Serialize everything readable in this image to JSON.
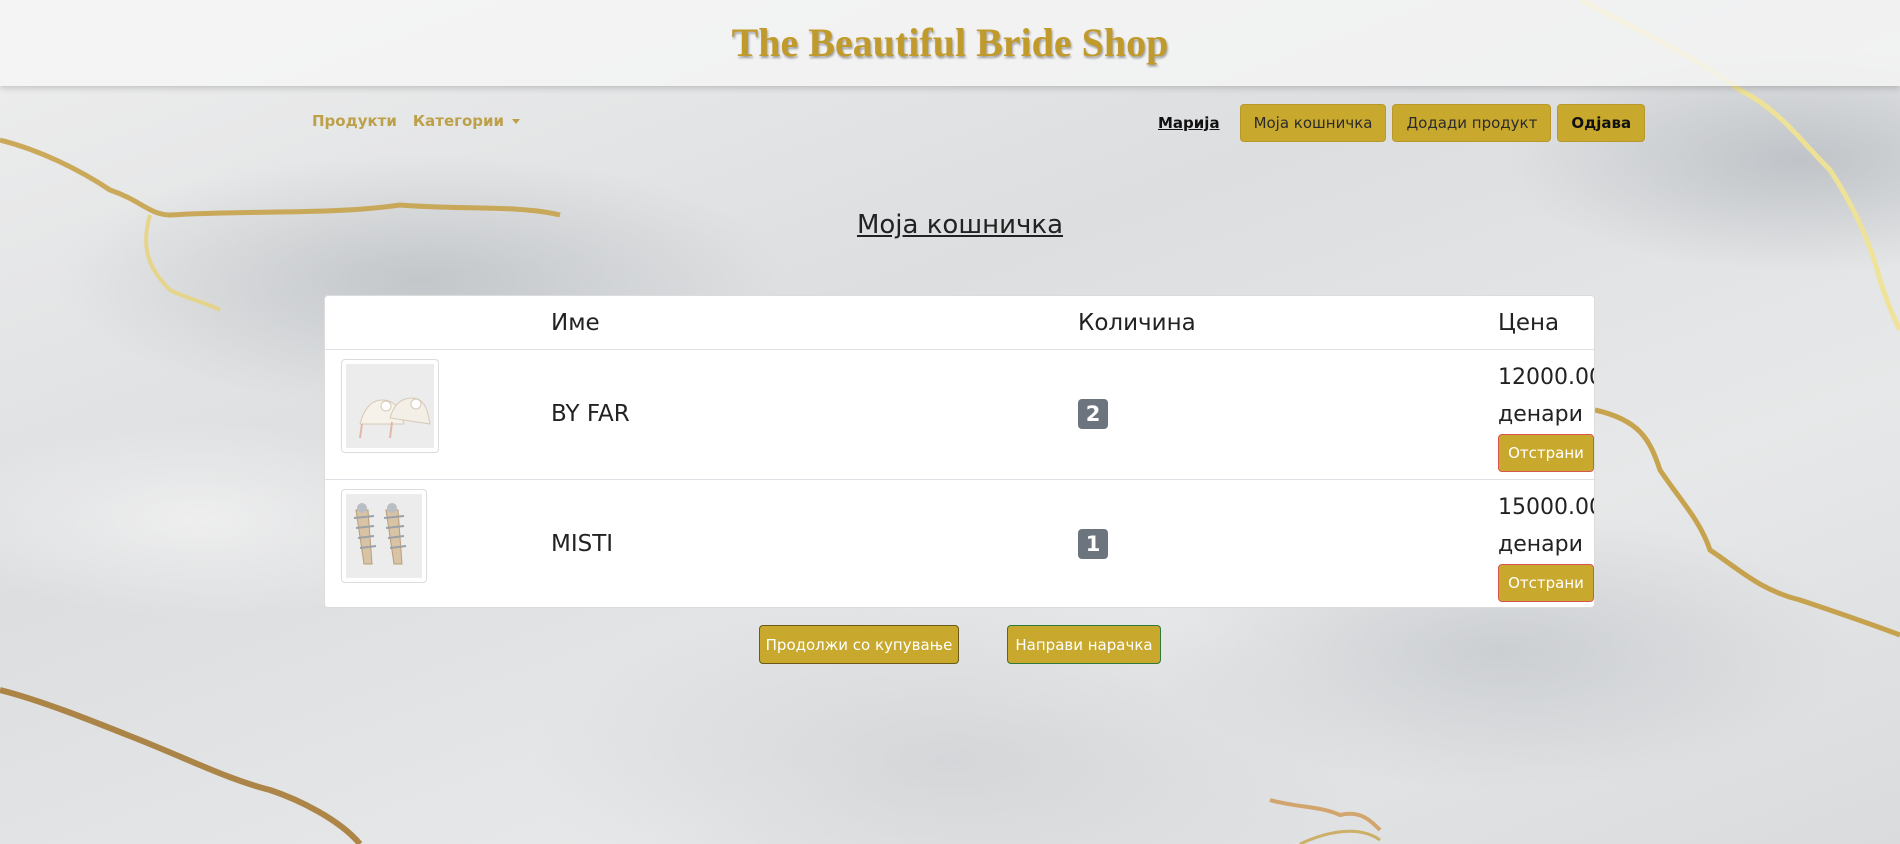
{
  "header": {
    "title": "The Beautiful Bride Shop"
  },
  "nav": {
    "products": "Продукти",
    "categories": "Категории",
    "user": "Марија",
    "cart": "Моја кошничка",
    "add_product": "Додади продукт",
    "logout": "Одјава"
  },
  "page": {
    "heading": "Моја кошничка"
  },
  "table": {
    "columns": [
      "",
      "Име",
      "Количина",
      "Цена"
    ],
    "rows": [
      {
        "name": "BY FAR",
        "quantity": "2",
        "price": "12000.00",
        "currency": "денари",
        "remove": "Отстрани",
        "image_icon": "heeled-mule-sandal-icon"
      },
      {
        "name": "MISTI",
        "quantity": "1",
        "price": "15000.00",
        "currency": "денари",
        "remove": "Отстрани",
        "image_icon": "strappy-heel-sandal-icon"
      }
    ]
  },
  "actions": {
    "continue_shopping": "Продолжи со купување",
    "place_order": "Направи нарачка"
  },
  "colors": {
    "gold": "#c8a92e",
    "title_gold": "#c19a2c",
    "badge": "#6c757d"
  }
}
